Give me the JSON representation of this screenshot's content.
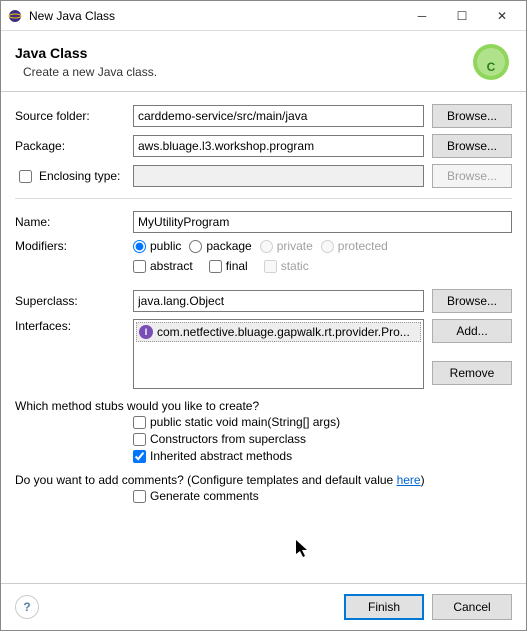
{
  "window": {
    "title": "New Java Class"
  },
  "header": {
    "title": "Java Class",
    "desc": "Create a new Java class."
  },
  "labels": {
    "sourceFolder": "Source folder:",
    "package": "Package:",
    "enclosingType": "Enclosing type:",
    "name": "Name:",
    "modifiers": "Modifiers:",
    "superclass": "Superclass:",
    "interfaces": "Interfaces:",
    "stubsQuestion": "Which method stubs would you like to create?",
    "commentsQuestion": "Do you want to add comments? (Configure templates and default value ",
    "commentsLink": "here",
    "commentsClose": ")"
  },
  "fields": {
    "sourceFolder": "carddemo-service/src/main/java",
    "package": "aws.bluage.l3.workshop.program",
    "enclosingType": "",
    "name": "MyUtilityProgram",
    "superclass": "java.lang.Object"
  },
  "buttons": {
    "browse": "Browse...",
    "add": "Add...",
    "remove": "Remove",
    "finish": "Finish",
    "cancel": "Cancel"
  },
  "modRadios": {
    "public": "public",
    "package": "package",
    "private": "private",
    "protected": "protected"
  },
  "modChecks": {
    "abstract": "abstract",
    "final": "final",
    "static": "static"
  },
  "interfaces": {
    "item0": "com.netfective.bluage.gapwalk.rt.provider.Pro..."
  },
  "stubs": {
    "main": "public static void main(String[] args)",
    "constructors": "Constructors from superclass",
    "inherited": "Inherited abstract methods"
  },
  "comments": {
    "generate": "Generate comments"
  }
}
